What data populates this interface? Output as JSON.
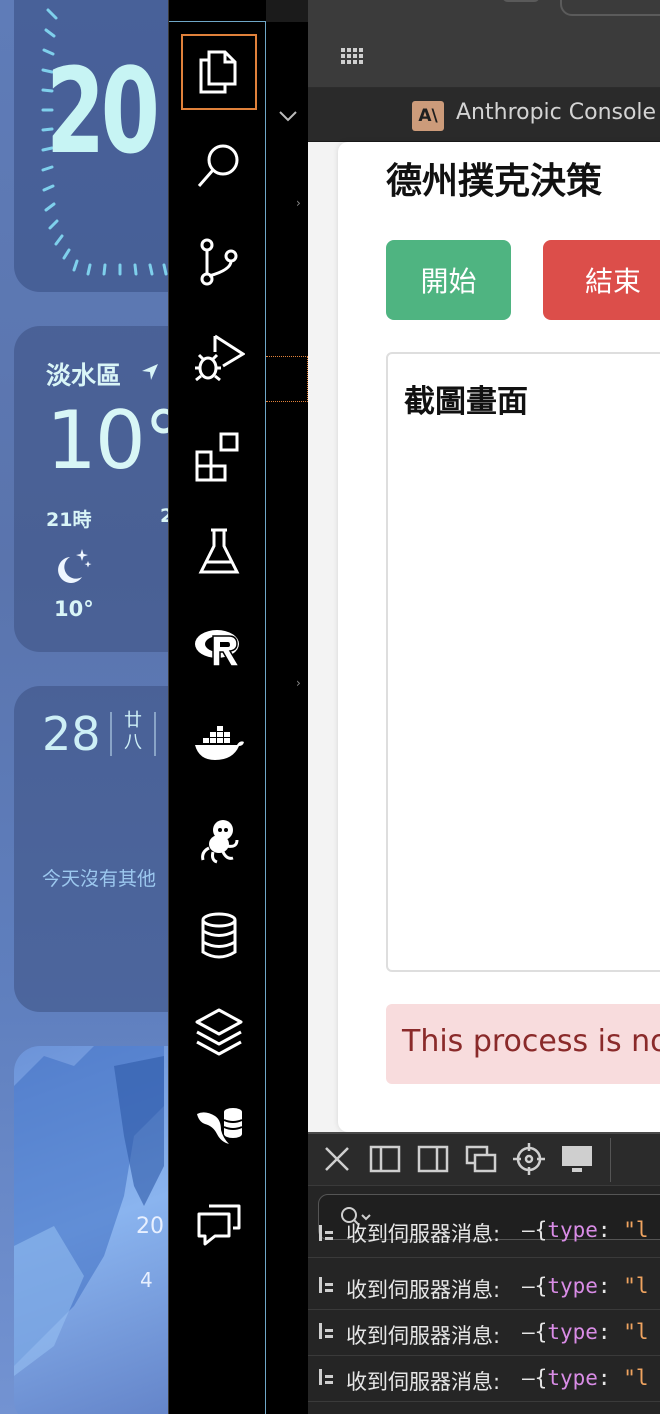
{
  "desktop": {
    "clock": {
      "time_partial": "20"
    },
    "weather": {
      "location": "淡水區",
      "temperature": "10°",
      "hour_label": "21時",
      "hour_label_2": "2",
      "hour_temp": "10°"
    },
    "calendar": {
      "day": "28",
      "lunar": "廿八",
      "message": "今天沒有其他"
    },
    "photo": {
      "year": "20",
      "sub": "4"
    }
  },
  "activity_bar": {
    "items": [
      {
        "name": "explorer",
        "icon": "files-icon"
      },
      {
        "name": "search",
        "icon": "search-icon"
      },
      {
        "name": "source-control",
        "icon": "source-control-icon"
      },
      {
        "name": "run-debug",
        "icon": "run-debug-icon"
      },
      {
        "name": "extensions",
        "icon": "extensions-icon"
      },
      {
        "name": "testing",
        "icon": "flask-icon"
      },
      {
        "name": "r",
        "icon": "r-language-icon"
      },
      {
        "name": "docker",
        "icon": "docker-icon"
      },
      {
        "name": "github",
        "icon": "octocat-icon"
      },
      {
        "name": "database",
        "icon": "database-icon"
      },
      {
        "name": "layers",
        "icon": "layers-icon"
      },
      {
        "name": "mysql",
        "icon": "mysql-icon"
      },
      {
        "name": "chat",
        "icon": "chat-icon"
      }
    ],
    "accent_color": "#e0813b"
  },
  "browser": {
    "tab": {
      "logo": "A\\",
      "title": "Anthropic Console"
    },
    "page": {
      "title": "德州撲克決策",
      "start_button": "開始",
      "end_button": "結束",
      "screenshot_title": "截圖畫面",
      "alert": "This process is no"
    },
    "colors": {
      "start": "#4fb481",
      "end": "#dc4e4a",
      "alert_bg": "#f8dcdd"
    },
    "devtools": {
      "logs": [
        {
          "message": "收到伺服器消息:",
          "dash": "–",
          "open": "{",
          "key": "type",
          "colon": ":",
          "value": "\"l"
        },
        {
          "message": "收到伺服器消息:",
          "dash": "–",
          "open": "{",
          "key": "type",
          "colon": ":",
          "value": "\"l"
        },
        {
          "message": "收到伺服器消息:",
          "dash": "–",
          "open": "{",
          "key": "type",
          "colon": ":",
          "value": "\"l"
        },
        {
          "message": "收到伺服器消息:",
          "dash": "–",
          "open": "{",
          "key": "type",
          "colon": ":",
          "value": "\"l"
        }
      ]
    }
  }
}
